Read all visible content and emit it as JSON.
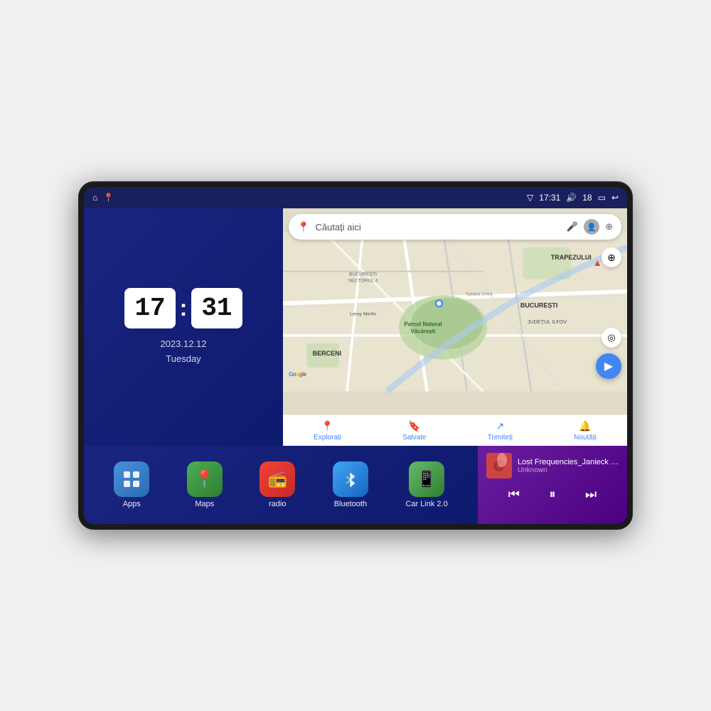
{
  "device": {
    "screen_bg": "#1a1f5e"
  },
  "status_bar": {
    "signal_icon": "▽",
    "time": "17:31",
    "volume_icon": "🔊",
    "volume_level": "18",
    "battery_icon": "▭",
    "back_icon": "↩"
  },
  "clock": {
    "hour": "17",
    "minute": "31",
    "date": "2023.12.12",
    "day": "Tuesday"
  },
  "map": {
    "search_placeholder": "Căutați aici",
    "mic_icon": "🎤",
    "nav_items": [
      {
        "label": "Explorați",
        "icon": "📍"
      },
      {
        "label": "Salvate",
        "icon": "🔖"
      },
      {
        "label": "Trimiteți",
        "icon": "↗"
      },
      {
        "label": "Noutăți",
        "icon": "🔔"
      }
    ],
    "labels": {
      "parcul": "Parcul Natural Văcărești",
      "leroy": "Leroy Merlin",
      "berceni": "BERCENI",
      "trapezului": "TRAPEZULUI",
      "bucuresti": "BUCUREȘTI",
      "judet": "JUDEȚUL ILFOV",
      "splaiul": "Splaiul Unirii",
      "sector4": "BUCUREȘTI SECTORUL 4"
    }
  },
  "apps": [
    {
      "id": "apps",
      "label": "Apps",
      "icon": "⊞",
      "bg_class": "apps-bg"
    },
    {
      "id": "maps",
      "label": "Maps",
      "icon": "📍",
      "bg_class": "maps-bg"
    },
    {
      "id": "radio",
      "label": "radio",
      "icon": "📻",
      "bg_class": "radio-bg"
    },
    {
      "id": "bluetooth",
      "label": "Bluetooth",
      "icon": "🔷",
      "bg_class": "bt-bg"
    },
    {
      "id": "carlink",
      "label": "Car Link 2.0",
      "icon": "📱",
      "bg_class": "carlink-bg"
    }
  ],
  "music": {
    "title": "Lost Frequencies_Janieck Devy-...",
    "artist": "Unknown",
    "prev_icon": "⏮",
    "play_icon": "⏸",
    "next_icon": "⏭"
  }
}
